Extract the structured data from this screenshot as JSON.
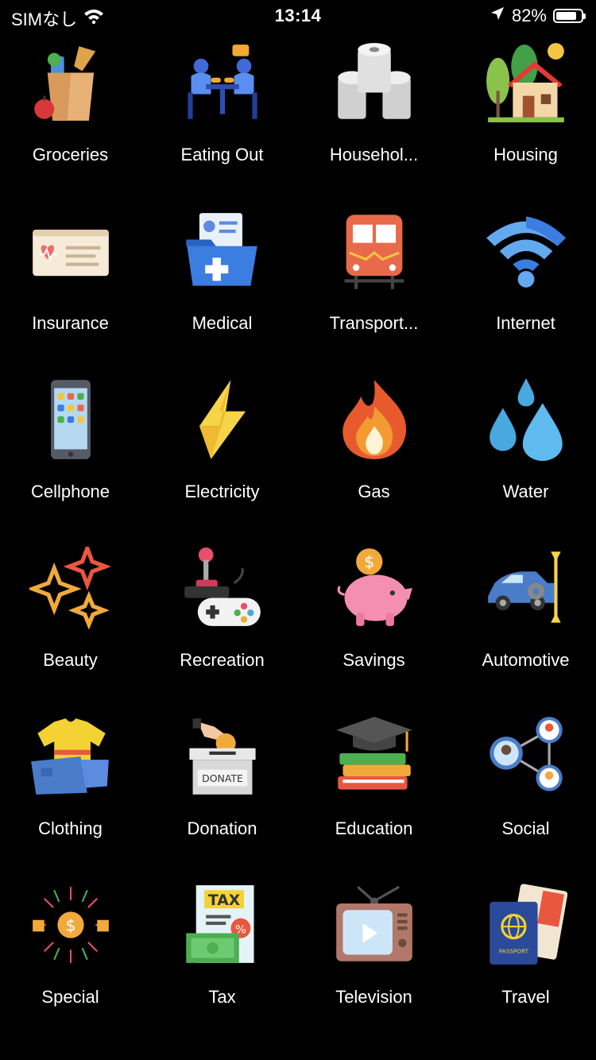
{
  "status": {
    "carrier": "SIMなし",
    "time": "13:14",
    "battery_text": "82%",
    "battery_level": 0.82
  },
  "categories": [
    {
      "label": "Groceries",
      "icon": "groceries-icon"
    },
    {
      "label": "Eating Out",
      "icon": "eating-out-icon"
    },
    {
      "label": "Househol...",
      "icon": "household-icon"
    },
    {
      "label": "Housing",
      "icon": "housing-icon"
    },
    {
      "label": "Insurance",
      "icon": "insurance-icon"
    },
    {
      "label": "Medical",
      "icon": "medical-icon"
    },
    {
      "label": "Transport...",
      "icon": "transport-icon"
    },
    {
      "label": "Internet",
      "icon": "internet-icon"
    },
    {
      "label": "Cellphone",
      "icon": "cellphone-icon"
    },
    {
      "label": "Electricity",
      "icon": "electricity-icon"
    },
    {
      "label": "Gas",
      "icon": "gas-icon"
    },
    {
      "label": "Water",
      "icon": "water-icon"
    },
    {
      "label": "Beauty",
      "icon": "beauty-icon"
    },
    {
      "label": "Recreation",
      "icon": "recreation-icon"
    },
    {
      "label": "Savings",
      "icon": "savings-icon"
    },
    {
      "label": "Automotive",
      "icon": "automotive-icon"
    },
    {
      "label": "Clothing",
      "icon": "clothing-icon"
    },
    {
      "label": "Donation",
      "icon": "donation-icon"
    },
    {
      "label": "Education",
      "icon": "education-icon"
    },
    {
      "label": "Social",
      "icon": "social-icon"
    },
    {
      "label": "Special",
      "icon": "special-icon"
    },
    {
      "label": "Tax",
      "icon": "tax-icon"
    },
    {
      "label": "Television",
      "icon": "television-icon"
    },
    {
      "label": "Travel",
      "icon": "travel-icon"
    }
  ],
  "icon_text": {
    "donate": "DONATE",
    "tax": "TAX",
    "passport": "PASSPORT",
    "dollar": "$",
    "percent": "%"
  }
}
